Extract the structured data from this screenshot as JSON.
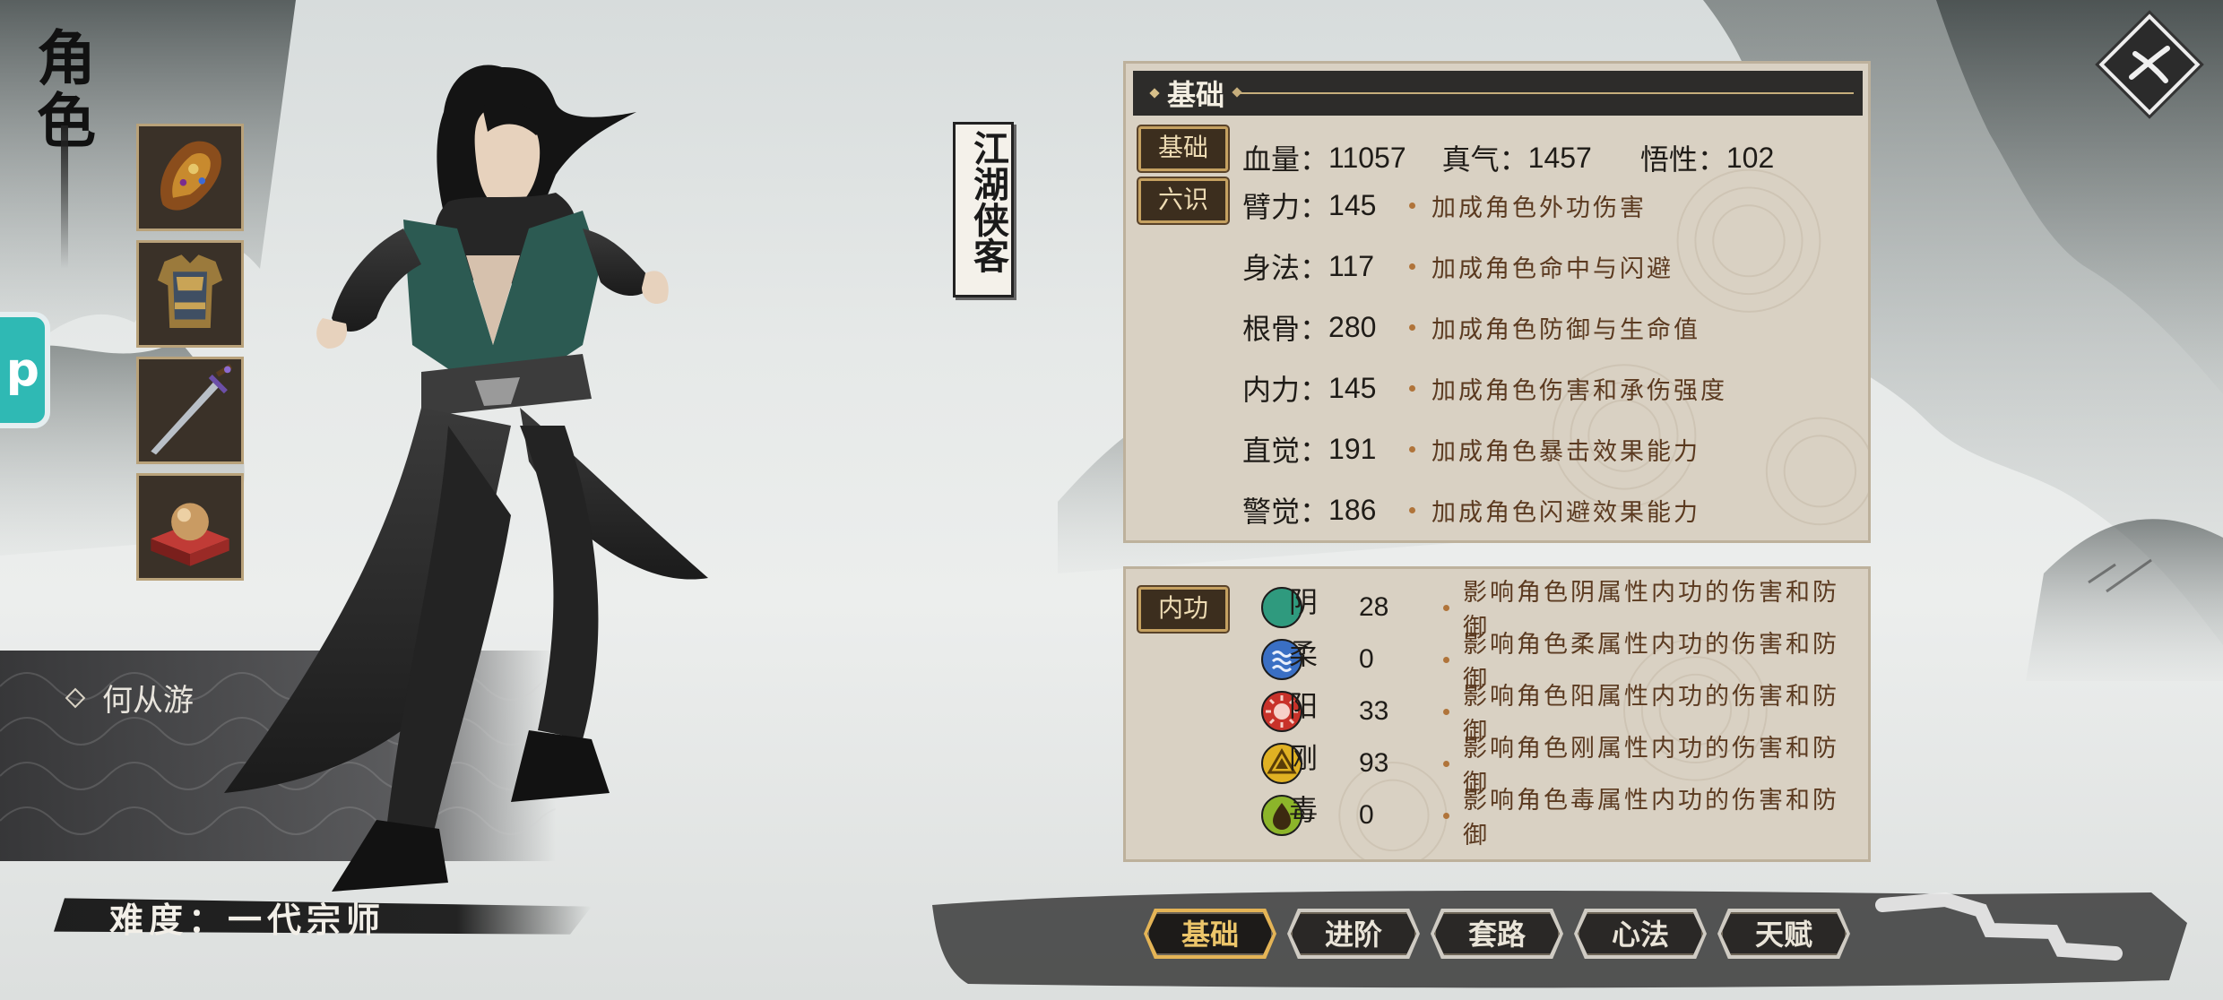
{
  "page": {
    "title_vertical": "角色",
    "banner": "江湖侠客",
    "character_name": "何从游",
    "difficulty": "难度：一代宗师",
    "side_tab_letter": "p"
  },
  "equipment": [
    {
      "slot": "gauntlet",
      "icon": "gauntlet-icon"
    },
    {
      "slot": "armor",
      "icon": "armor-icon"
    },
    {
      "slot": "weapon",
      "icon": "sword-icon"
    },
    {
      "slot": "artifact",
      "icon": "orb-pedestal-icon"
    }
  ],
  "basic_panel": {
    "header": "基础",
    "badge_basic": "基础",
    "hp_label": "血量：",
    "hp_value": "11057",
    "qi_label": "真气：",
    "qi_value": "1457",
    "wuxing_label": "悟性：",
    "wuxing_value": "102",
    "badge_six": "六识",
    "stats": [
      {
        "label": "臂力：",
        "value": "145",
        "desc": "加成角色外功伤害"
      },
      {
        "label": "身法：",
        "value": "117",
        "desc": "加成角色命中与闪避"
      },
      {
        "label": "根骨：",
        "value": "280",
        "desc": "加成角色防御与生命值"
      },
      {
        "label": "内力：",
        "value": "145",
        "desc": "加成角色伤害和承伤强度"
      },
      {
        "label": "直觉：",
        "value": "191",
        "desc": "加成角色暴击效果能力"
      },
      {
        "label": "警觉：",
        "value": "186",
        "desc": "加成角色闪避效果能力"
      }
    ]
  },
  "neigong_panel": {
    "badge": "内功",
    "elements": [
      {
        "char": "阴",
        "value": "28",
        "desc": "影响角色阴属性内功的伤害和防御",
        "color": "#2f9a7e",
        "icon": "yin-icon"
      },
      {
        "char": "柔",
        "value": "0",
        "desc": "影响角色柔属性内功的伤害和防御",
        "color": "#3a6fc4",
        "icon": "rou-icon"
      },
      {
        "char": "阳",
        "value": "33",
        "desc": "影响角色阳属性内功的伤害和防御",
        "color": "#c8322a",
        "icon": "yang-icon"
      },
      {
        "char": "刚",
        "value": "93",
        "desc": "影响角色刚属性内功的伤害和防御",
        "color": "#e0b123",
        "icon": "gang-icon"
      },
      {
        "char": "毒",
        "value": "0",
        "desc": "影响角色毒属性内功的伤害和防御",
        "color": "#8cb52a",
        "icon": "du-icon"
      }
    ]
  },
  "tabs": [
    {
      "label": "基础",
      "active": true
    },
    {
      "label": "进阶",
      "active": false
    },
    {
      "label": "套路",
      "active": false
    },
    {
      "label": "心法",
      "active": false
    },
    {
      "label": "天赋",
      "active": false
    }
  ],
  "colors": {
    "panel_bg": "#d9d1c3",
    "header_bg": "#2d2c2a",
    "badge_border": "#c5a161",
    "desc_text": "#5b3a20",
    "active_tab_text": "#ecc56a"
  }
}
